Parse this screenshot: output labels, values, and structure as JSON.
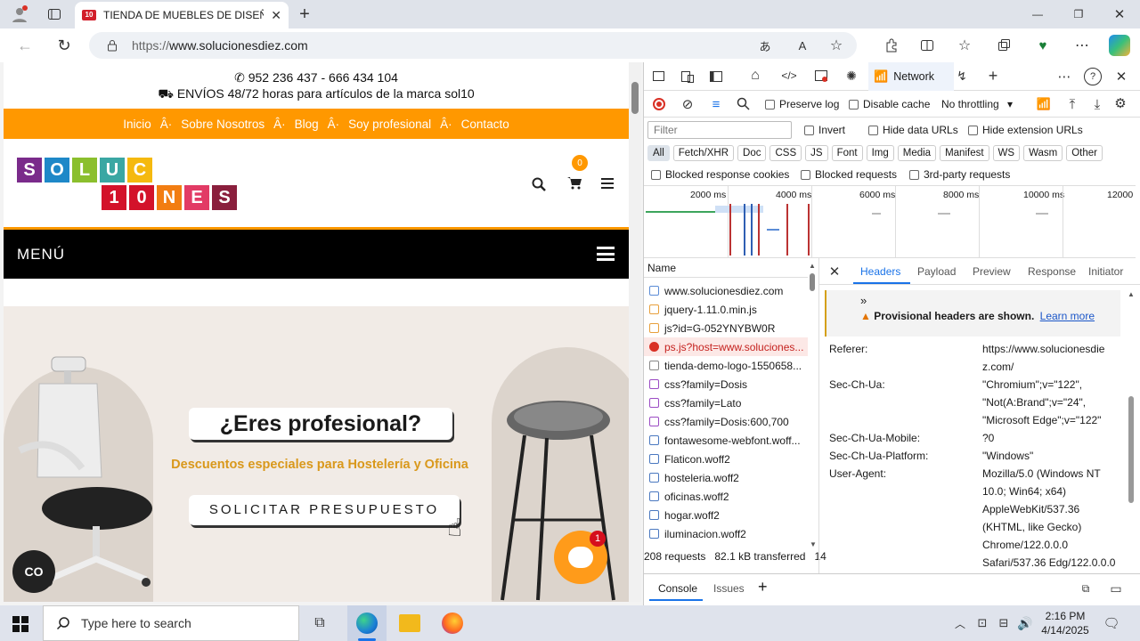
{
  "browser": {
    "tab_title": "TIENDA DE MUEBLES DE DISEÑO",
    "url_prefix": "https://",
    "url_host": "www.solucionesdiez.com"
  },
  "site": {
    "phones": "952 236 437 - 666 434 104",
    "shipping": "ENVÍOS 48/72 horas para artículos de la marca sol10",
    "nav": [
      "Inicio",
      "Sobre Nosotros",
      "Blog",
      "Soy profesional",
      "Contacto"
    ],
    "nav_sep": "Â·",
    "logo_top": [
      "S",
      "O",
      "L",
      "U",
      "C"
    ],
    "logo_bottom": [
      "1",
      "0",
      "N",
      "E",
      "S"
    ],
    "cart_count": "0",
    "menu_label": "MENÚ",
    "hero_title": "¿Eres profesional?",
    "hero_subtitle": "Descuentos especiales para Hostelería y Oficina",
    "hero_button": "SOLICITAR PRESUPUESTO",
    "chat_badge": "1",
    "cookie_icon": "CO"
  },
  "devtools": {
    "panel_tab": "Network",
    "preserve_log": "Preserve log",
    "disable_cache": "Disable cache",
    "throttling": "No throttling",
    "filter_placeholder": "Filter",
    "invert": "Invert",
    "hide_data_urls": "Hide data URLs",
    "hide_extension_urls": "Hide extension URLs",
    "type_filters": [
      "All",
      "Fetch/XHR",
      "Doc",
      "CSS",
      "JS",
      "Font",
      "Img",
      "Media",
      "Manifest",
      "WS",
      "Wasm",
      "Other"
    ],
    "blocked_response_cookies": "Blocked response cookies",
    "blocked_requests": "Blocked requests",
    "third_party": "3rd-party requests",
    "timeline_ticks": [
      "2000 ms",
      "4000 ms",
      "6000 ms",
      "8000 ms",
      "10000 ms",
      "12000"
    ],
    "name_header": "Name",
    "requests": [
      {
        "name": "www.solucionesdiez.com",
        "kind": "doc"
      },
      {
        "name": "jquery-1.11.0.min.js",
        "kind": "js"
      },
      {
        "name": "js?id=G-052YNYBW0R",
        "kind": "js"
      },
      {
        "name": "ps.js?host=www.soluciones...",
        "kind": "error"
      },
      {
        "name": "tienda-demo-logo-1550658...",
        "kind": "img"
      },
      {
        "name": "css?family=Dosis",
        "kind": "css"
      },
      {
        "name": "css?family=Lato",
        "kind": "css"
      },
      {
        "name": "css?family=Dosis:600,700",
        "kind": "css"
      },
      {
        "name": "fontawesome-webfont.woff...",
        "kind": "font"
      },
      {
        "name": "Flaticon.woff2",
        "kind": "font"
      },
      {
        "name": "hosteleria.woff2",
        "kind": "font"
      },
      {
        "name": "oficinas.woff2",
        "kind": "font"
      },
      {
        "name": "hogar.woff2",
        "kind": "font"
      },
      {
        "name": "iluminacion.woff2",
        "kind": "font"
      }
    ],
    "status_bar": "208 requests   82.1 kB transferred   14",
    "detail_tabs": [
      "Headers",
      "Payload",
      "Preview",
      "Response",
      "Initiator"
    ],
    "provisional": "Provisional headers are shown.",
    "learn_more": "Learn more",
    "headers": [
      {
        "k": "Referer:",
        "v": [
          "https://www.solucionesdie",
          "z.com/"
        ]
      },
      {
        "k": "Sec-Ch-Ua:",
        "v": [
          "\"Chromium\";v=\"122\",",
          "\"Not(A:Brand\";v=\"24\",",
          "\"Microsoft Edge\";v=\"122\""
        ]
      },
      {
        "k": "Sec-Ch-Ua-Mobile:",
        "v": [
          "?0"
        ]
      },
      {
        "k": "Sec-Ch-Ua-Platform:",
        "v": [
          "\"Windows\""
        ]
      },
      {
        "k": "User-Agent:",
        "v": [
          "Mozilla/5.0 (Windows NT",
          "10.0; Win64; x64)",
          "AppleWebKit/537.36",
          "(KHTML, like Gecko)",
          "Chrome/122.0.0.0",
          "Safari/537.36 Edg/122.0.0.0"
        ]
      }
    ],
    "drawer_console": "Console",
    "drawer_issues": "Issues"
  },
  "taskbar": {
    "search_placeholder": "Type here to search",
    "time": "2:16 PM",
    "date": "4/14/2025"
  },
  "colors": {
    "orange": "#ff9800",
    "black": "#000000",
    "accent_blue": "#1a73e8"
  }
}
